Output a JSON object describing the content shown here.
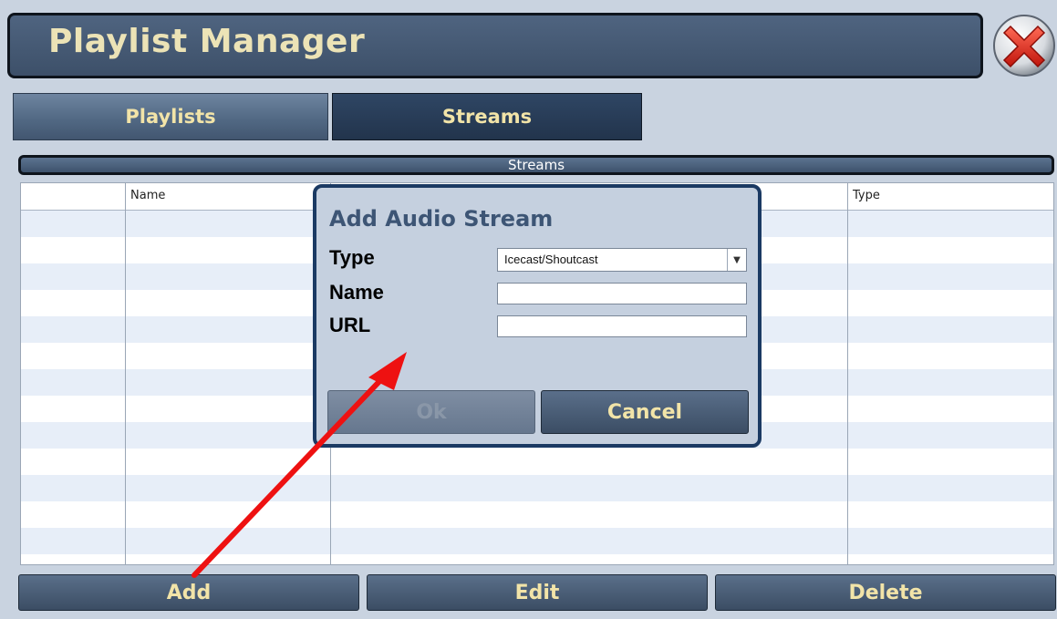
{
  "window": {
    "title": "Playlist Manager"
  },
  "tabs": [
    {
      "label": "Playlists",
      "active": false
    },
    {
      "label": "Streams",
      "active": true
    }
  ],
  "section": {
    "title": "Streams"
  },
  "table": {
    "columns": [
      "",
      "Name",
      "",
      "Type"
    ]
  },
  "dialog": {
    "title": "Add Audio Stream",
    "type_label": "Type",
    "type_value": "Icecast/Shoutcast",
    "name_label": "Name",
    "name_value": "",
    "url_label": "URL",
    "url_value": "",
    "ok_label": "Ok",
    "cancel_label": "Cancel"
  },
  "buttons": {
    "add": "Add",
    "edit": "Edit",
    "delete": "Delete"
  },
  "colors": {
    "accent_text": "#f2e4a8",
    "title_text": "#ece3b6",
    "annotation_arrow": "#ee1111",
    "close_icon": "#e0281f"
  },
  "icons": {
    "close": "close-x-icon",
    "dropdown": "chevron-down-icon"
  }
}
